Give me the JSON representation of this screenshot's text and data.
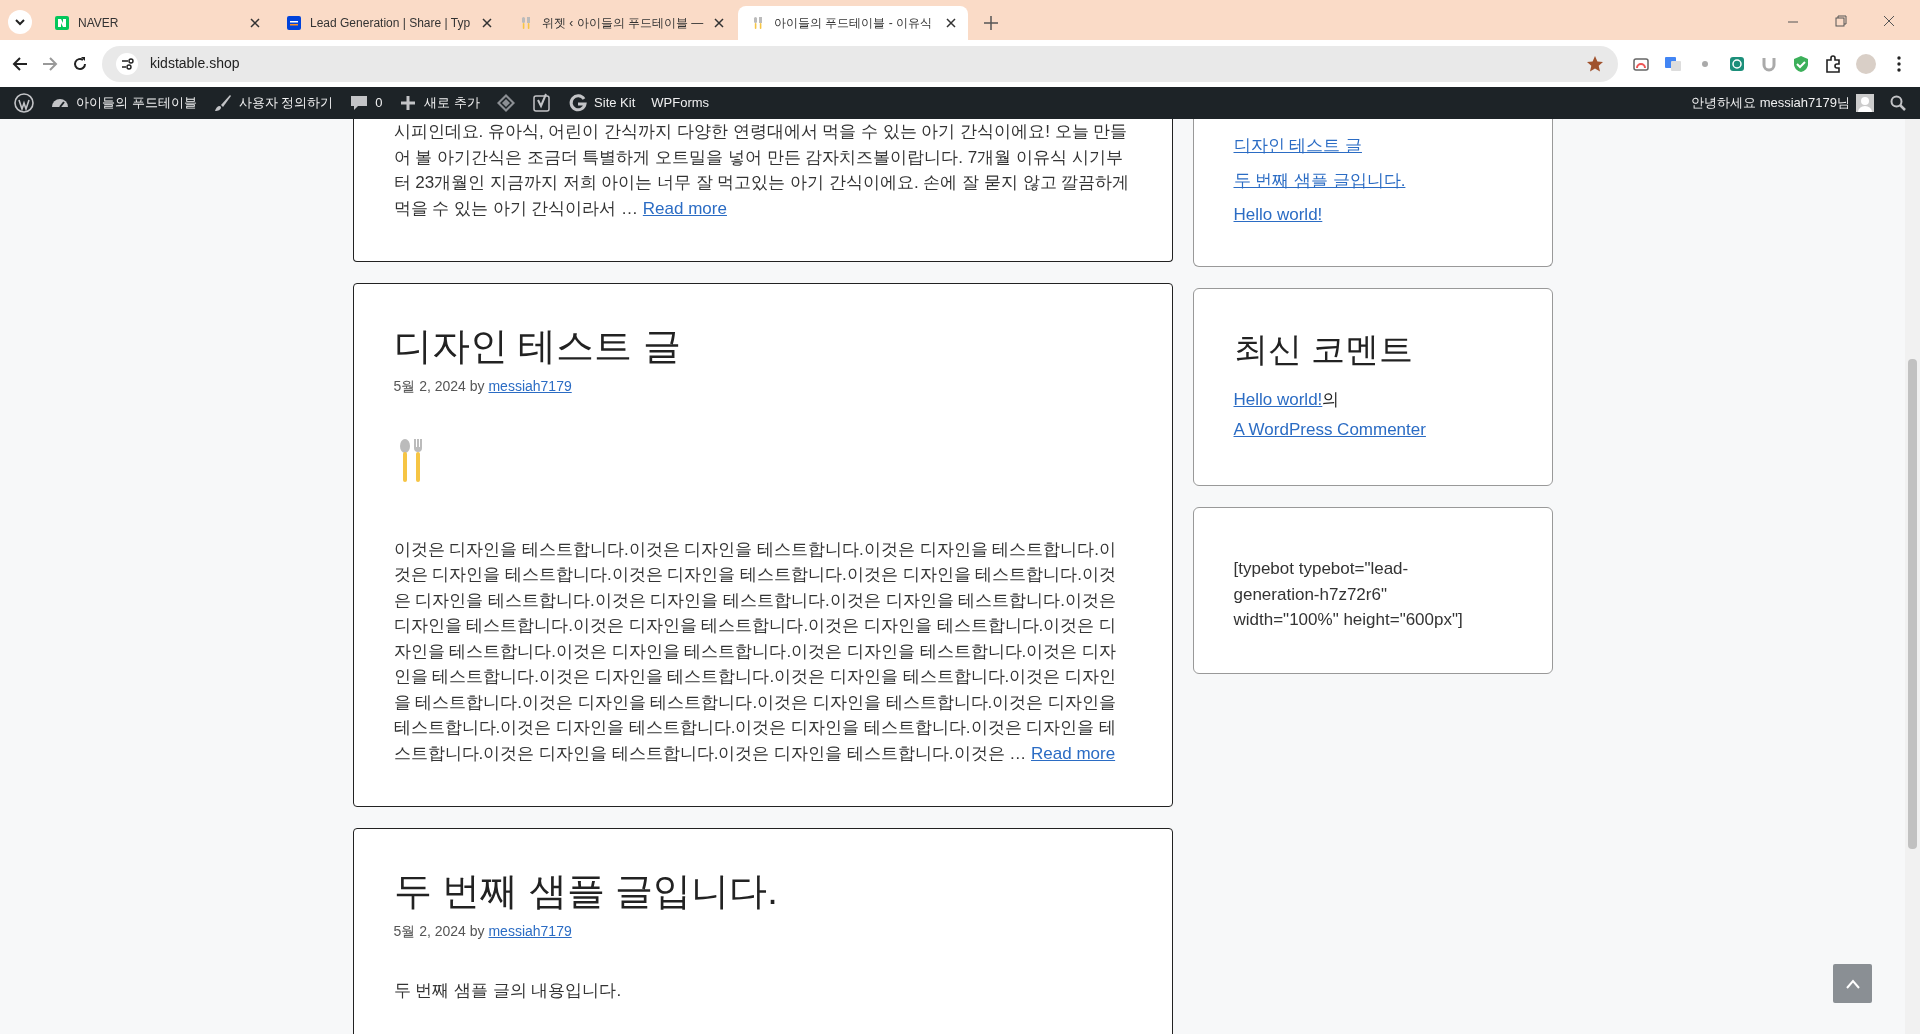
{
  "browser": {
    "tabs": [
      {
        "title": "NAVER",
        "kind": "naver",
        "selected": false
      },
      {
        "title": "Lead Generation | Share | Typ",
        "kind": "typebot",
        "selected": false
      },
      {
        "title": "위젯 ‹ 아이들의 푸드테이블 —",
        "kind": "site",
        "selected": false
      },
      {
        "title": "아이들의 푸드테이블 - 이유식",
        "kind": "site",
        "selected": true
      }
    ],
    "address": "kidstable.shop",
    "bookmarked": true
  },
  "admin_bar": {
    "left": [
      {
        "kind": "wp"
      },
      {
        "kind": "dashboard",
        "label": "아이들의 푸드테이블"
      },
      {
        "kind": "brush",
        "label": "사용자 정의하기"
      },
      {
        "kind": "comment",
        "label": "0"
      },
      {
        "kind": "plus",
        "label": "새로 추가"
      },
      {
        "kind": "diamond"
      },
      {
        "kind": "yoast"
      },
      {
        "kind": "g",
        "label": "Site Kit"
      },
      {
        "kind": "text",
        "label": "WPForms"
      }
    ],
    "greeting": "안녕하세요 messiah7179님"
  },
  "posts": [
    {
      "excerpt": "시피인데요. 유아식, 어린이 간식까지 다양한 연령대에서 먹을 수 있는 아기 간식이에요! 오늘 만들어 볼 아기간식은 조금더 특별하게 오트밀을 넣어 만든 감자치즈볼이랍니다. 7개월 이유식 시기부터 23개월인 지금까지 저희 아이는 너무 잘 먹고있는 아기 간식이에요. 손에 잘 묻지 않고 깔끔하게 먹을 수 있는 아기 간식이라서 …",
      "read_more": "Read more"
    },
    {
      "title": "디자인 테스트 글",
      "date": "5월 2, 2024",
      "by": "by",
      "author": "messiah7179",
      "image": true,
      "excerpt": "이것은 디자인을 테스트합니다.이것은 디자인을 테스트합니다.이것은 디자인을 테스트합니다.이것은 디자인을 테스트합니다.이것은 디자인을 테스트합니다.이것은 디자인을 테스트합니다.이것은 디자인을 테스트합니다.이것은 디자인을 테스트합니다.이것은 디자인을 테스트합니다.이것은 디자인을 테스트합니다.이것은 디자인을 테스트합니다.이것은 디자인을 테스트합니다.이것은 디자인을 테스트합니다.이것은 디자인을 테스트합니다.이것은 디자인을 테스트합니다.이것은 디자인을 테스트합니다.이것은 디자인을 테스트합니다.이것은 디자인을 테스트합니다.이것은 디자인을 테스트합니다.이것은 디자인을 테스트합니다.이것은 디자인을 테스트합니다.이것은 디자인을 테스트합니다.이것은 디자인을 테스트합니다.이것은 디자인을 테스트합니다.이것은 디자인을 테스트합니다.이것은 디자인을 테스트합니다.이것은 디자인을 테스트합니다.이것은 …",
      "read_more": "Read more"
    },
    {
      "title": "두 번째 샘플 글입니다.",
      "date": "5월 2, 2024",
      "by": "by",
      "author": "messiah7179",
      "content": "두 번째 샘플 글의 내용입니다."
    }
  ],
  "sidebar": {
    "recent_posts": [
      "디자인 테스트 글",
      "두 번째 샘플 글입니다.",
      "Hello world!"
    ],
    "recent_comments": {
      "title": "최신 코멘트",
      "post": "Hello world!",
      "connector": "의",
      "author": "A WordPress Commenter"
    },
    "shortcode": "[typebot typebot=\"lead-generation-h7z72r6\" width=\"100%\" height=\"600px\"]"
  }
}
